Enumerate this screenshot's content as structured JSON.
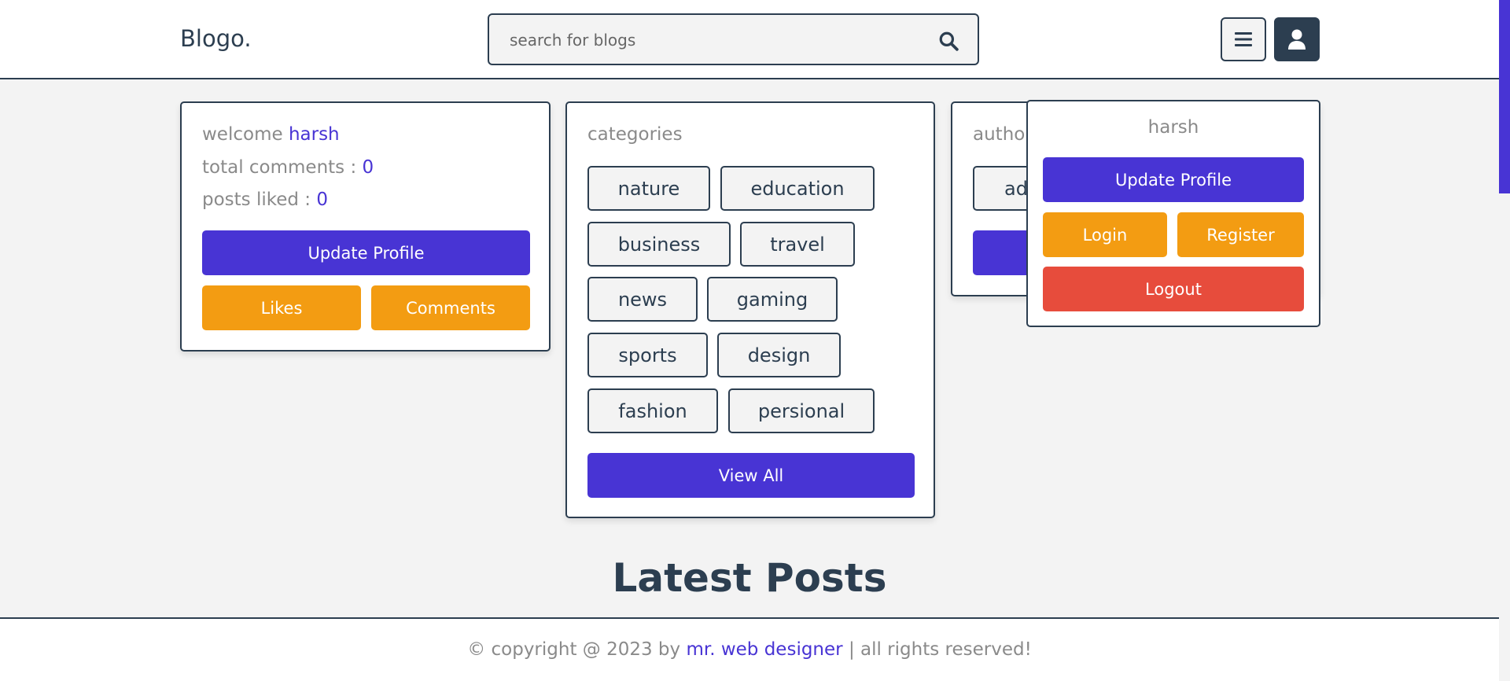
{
  "header": {
    "logo": "Blogo.",
    "search_placeholder": "search for blogs"
  },
  "icons": {
    "search": "search-icon",
    "menu": "hamburger-menu-icon",
    "user": "user-icon"
  },
  "welcome_card": {
    "welcome_label": "welcome",
    "username": "harsh",
    "total_comments_label": "total comments :",
    "total_comments_value": "0",
    "posts_liked_label": "posts liked :",
    "posts_liked_value": "0",
    "update_profile": "Update Profile",
    "likes": "Likes",
    "comments": "Comments"
  },
  "categories_card": {
    "title": "categories",
    "tags": [
      "nature",
      "education",
      "business",
      "travel",
      "news",
      "gaming",
      "sports",
      "design",
      "fashion",
      "persional"
    ],
    "view_all": "View All"
  },
  "authors_card": {
    "title_visible": "autho",
    "tag_visible": "ad"
  },
  "profile_dropdown": {
    "name": "harsh",
    "update_profile": "Update Profile",
    "login": "Login",
    "register": "Register",
    "logout": "Logout"
  },
  "latest_posts_heading": "Latest Posts",
  "footer": {
    "prefix": "© copyright @ 2023 by",
    "author": "mr. web designer",
    "suffix": "| all rights reserved!"
  },
  "colors": {
    "accent_purple": "#4834d4",
    "orange": "#f39c12",
    "red": "#e74c3c",
    "dark": "#2c3e50",
    "background": "#f3f3f3"
  }
}
